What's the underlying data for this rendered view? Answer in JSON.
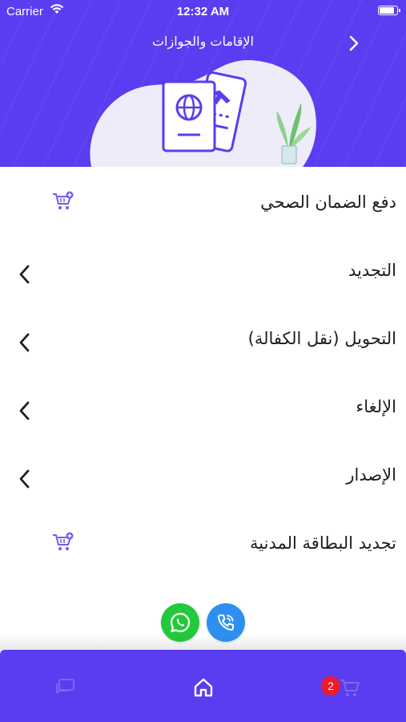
{
  "status_bar": {
    "carrier": "Carrier",
    "time": "12:32 AM"
  },
  "header": {
    "title": "الإقامات والجوازات"
  },
  "services": [
    {
      "label": "دفع الضمان الصحي",
      "action": "cart-icon"
    },
    {
      "label": "التجديد",
      "action": "chevron-left-icon"
    },
    {
      "label": "التحويل (نقل الكفالة)",
      "action": "chevron-left-icon"
    },
    {
      "label": "الإلغاء",
      "action": "chevron-left-icon"
    },
    {
      "label": "الإصدار",
      "action": "chevron-left-icon"
    },
    {
      "label": "تجديد البطاقة المدنية",
      "action": "cart-icon"
    }
  ],
  "tab_bar": {
    "cart_badge": "2"
  },
  "colors": {
    "primary": "#5b3cf0",
    "whatsapp": "#22c93a",
    "phone": "#2f8ff0",
    "badge": "#ef1b2a"
  }
}
